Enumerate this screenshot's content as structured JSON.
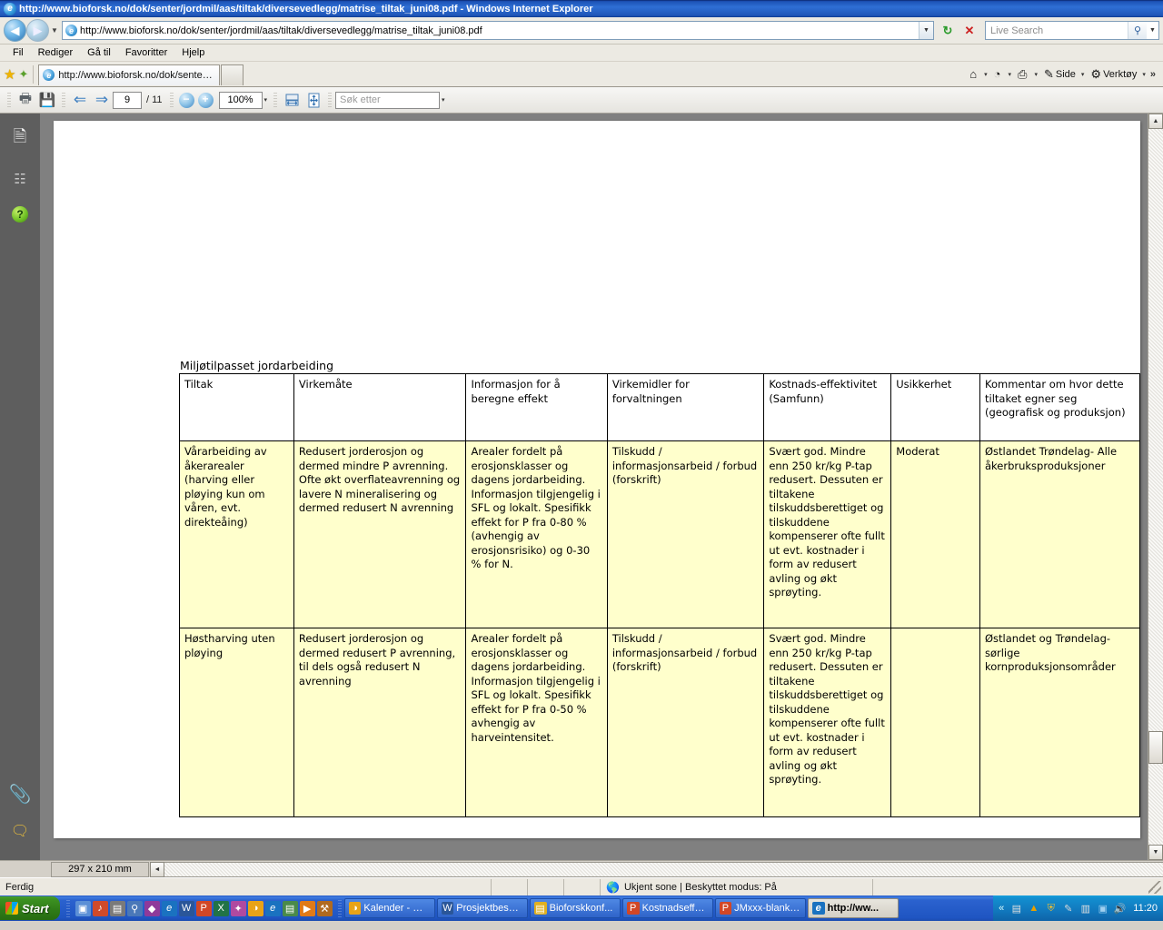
{
  "window": {
    "title": "http://www.bioforsk.no/dok/senter/jordmil/aas/tiltak/diversevedlegg/matrise_tiltak_juni08.pdf - Windows Internet Explorer",
    "app_icon": "ie-logo-icon"
  },
  "nav": {
    "back_label": "◀",
    "forward_label": "▶",
    "history_dropdown": "▼",
    "address_value": "http://www.bioforsk.no/dok/senter/jordmil/aas/tiltak/diversevedlegg/matrise_tiltak_juni08.pdf",
    "address_dropdown": "▼",
    "refresh_label": "↻",
    "stop_label": "✕",
    "search_placeholder": "Live Search",
    "search_go": "⚲",
    "search_dropdown": "▼"
  },
  "menu": {
    "items": [
      "Fil",
      "Rediger",
      "Gå til",
      "Favoritter",
      "Hjelp"
    ]
  },
  "command_bar": {
    "favorites_star": "★",
    "add_favorites": "✦",
    "tab_label": "http://www.bioforsk.no/dok/senter/jordmil/aas/tiltak/d...",
    "new_tab_label": "",
    "home_label": "⌂",
    "feeds_label": "◔",
    "print_label": "⎙",
    "page_label": "Side",
    "tools_label": "Verktøy",
    "overflow_label": "»",
    "caret": "▾"
  },
  "pdf_toolbar": {
    "print_icon": "printer-icon",
    "save_icon": "save-icon",
    "prev_page": "⇐",
    "next_page": "⇒",
    "page_current": "9",
    "page_total": "/ 11",
    "zoom_out": "−",
    "zoom_in": "+",
    "zoom_value": "100%",
    "zoom_dropdown": "▾",
    "fit_width_icon": "fit-width-icon",
    "fit_page_icon": "fit-page-icon",
    "find_placeholder": "Søk etter",
    "find_dropdown": "▾"
  },
  "pdf_sidebar": {
    "pages_icon": "pages-panel-icon",
    "search_icon": "binoculars-icon",
    "help_icon": "help-icon",
    "attachments_icon": "paperclip-icon",
    "comments_icon": "comments-icon"
  },
  "document": {
    "caption": "Miljøtilpasset jordarbeiding",
    "table": {
      "headers": [
        "Tiltak",
        "Virkemåte",
        "Informasjon for å beregne effekt",
        "Virkemidler for forvaltningen",
        "Kostnads-effektivitet (Samfunn)",
        "Usikkerhet",
        "Kommentar om hvor dette tiltaket egner seg (geografisk og produksjon)"
      ],
      "rows": [
        [
          "Vårarbeiding av åkerarealer (harving eller pløying kun om våren, evt. direkteåing)",
          "Redusert jorderosjon og dermed mindre P avrenning. Ofte økt overflateavrenning og lavere N mineralisering og dermed redusert N avrenning",
          "Arealer fordelt på erosjonsklasser og dagens jordarbeiding. Informasjon tilgjengelig i SFL og lokalt. Spesifikk effekt for P fra 0-80 % (avhengig av erosjonsrisiko) og 0-30 % for N.",
          "Tilskudd / informasjonsarbeid / forbud (forskrift)",
          "Svært god. Mindre enn 250 kr/kg P-tap redusert. Dessuten er tiltakene tilskuddsberettiget og tilskuddene kompenserer ofte fullt ut evt. kostnader i form av redusert avling og økt sprøyting.",
          "Moderat",
          "Østlandet Trøndelag- Alle åkerbruksproduksjoner"
        ],
        [
          "Høstharving uten pløying",
          "Redusert jorderosjon og dermed redusert P avrenning, til dels også redusert N avrenning",
          "Arealer fordelt på erosjonsklasser og dagens jordarbeiding. Informasjon tilgjengelig i SFL og lokalt. Spesifikk effekt for P fra 0-50 % avhengig av harveintensitet.",
          "Tilskudd / informasjonsarbeid / forbud (forskrift)",
          "Svært god. Mindre enn 250 kr/kg P-tap redusert. Dessuten er tiltakene tilskuddsberettiget og tilskuddene kompenserer ofte fullt ut evt. kostnader i form av redusert avling og økt sprøyting.",
          "",
          "Østlandet og Trøndelag- sørlige kornproduksjonsområder"
        ]
      ],
      "cell_background": "#ffffcc"
    }
  },
  "page_size_bar": {
    "size_label": "297 x 210 mm",
    "scroll_left": "◄"
  },
  "status_bar": {
    "message": "Ferdig",
    "zone": "Ukjent sone | Beskyttet modus: På",
    "globe_icon": "globe-icon"
  },
  "taskbar": {
    "start_label": "Start",
    "quick_launch": [
      {
        "name": "show-desktop-icon",
        "glyph": "▣",
        "color": "#5b8fd6"
      },
      {
        "name": "media-icon",
        "glyph": "♫",
        "color": "#d04a2a"
      },
      {
        "name": "network-icon",
        "glyph": "▤",
        "color": "#7a7a7a"
      },
      {
        "name": "search-icon",
        "glyph": "⚲",
        "color": "#4a78b8"
      },
      {
        "name": "acrobat-icon",
        "glyph": "◆",
        "color": "#8f3a9a"
      },
      {
        "name": "internet-explorer-icon",
        "glyph": "e",
        "color": "#1a72c0"
      },
      {
        "name": "word-icon",
        "glyph": "W",
        "color": "#2a5699"
      },
      {
        "name": "powerpoint-icon",
        "glyph": "P",
        "color": "#d24726"
      },
      {
        "name": "excel-icon",
        "glyph": "X",
        "color": "#217346"
      },
      {
        "name": "paint-icon",
        "glyph": "✦",
        "color": "#b04aa0"
      },
      {
        "name": "outlook-icon",
        "glyph": "◑",
        "color": "#e8a317"
      },
      {
        "name": "browser2-icon",
        "glyph": "e",
        "color": "#1a72c0"
      },
      {
        "name": "notes-icon",
        "glyph": "▤",
        "color": "#4a8a4a"
      },
      {
        "name": "player-icon",
        "glyph": "▶",
        "color": "#e07a18"
      },
      {
        "name": "tool-icon",
        "glyph": "⚒",
        "color": "#b06a20"
      }
    ],
    "windows": [
      {
        "label": "Kalender - Mi...",
        "icon": "outlook-icon",
        "icon_glyph": "◑",
        "icon_color": "#e8a317",
        "active": false
      },
      {
        "label": "Prosjektbeskr...",
        "icon": "word-icon",
        "icon_glyph": "W",
        "icon_color": "#2a5699",
        "active": false
      },
      {
        "label": "Bioforskkonf...",
        "icon": "folder-icon",
        "icon_glyph": "▤",
        "icon_color": "#e0b020",
        "active": false
      },
      {
        "label": "Kostnadseff_...",
        "icon": "powerpoint-icon",
        "icon_glyph": "P",
        "icon_color": "#d24726",
        "active": false
      },
      {
        "label": "JMxxx-blanke...",
        "icon": "powerpoint-icon",
        "icon_glyph": "P",
        "icon_color": "#d24726",
        "active": false
      },
      {
        "label": "http://ww...",
        "icon": "internet-explorer-icon",
        "icon_glyph": "e",
        "icon_color": "#1a72c0",
        "active": true
      }
    ],
    "tray": {
      "expand": "«",
      "icons": [
        {
          "name": "notes-tray-icon",
          "glyph": "▤",
          "color": "#e0e0e0"
        },
        {
          "name": "adobe-tray-icon",
          "glyph": "▲",
          "color": "#e8a100"
        },
        {
          "name": "security-tray-icon",
          "glyph": "⛨",
          "color": "#f0c030"
        },
        {
          "name": "pen-tray-icon",
          "glyph": "✐",
          "color": "#d8d8d8"
        },
        {
          "name": "battery-tray-icon",
          "glyph": "▥",
          "color": "#e0e0e0"
        },
        {
          "name": "network-tray-icon",
          "glyph": "▣",
          "color": "#a0d0f0"
        },
        {
          "name": "volume-tray-icon",
          "glyph": "🔊",
          "color": "#ffffff"
        }
      ],
      "clock": "11:20"
    }
  }
}
